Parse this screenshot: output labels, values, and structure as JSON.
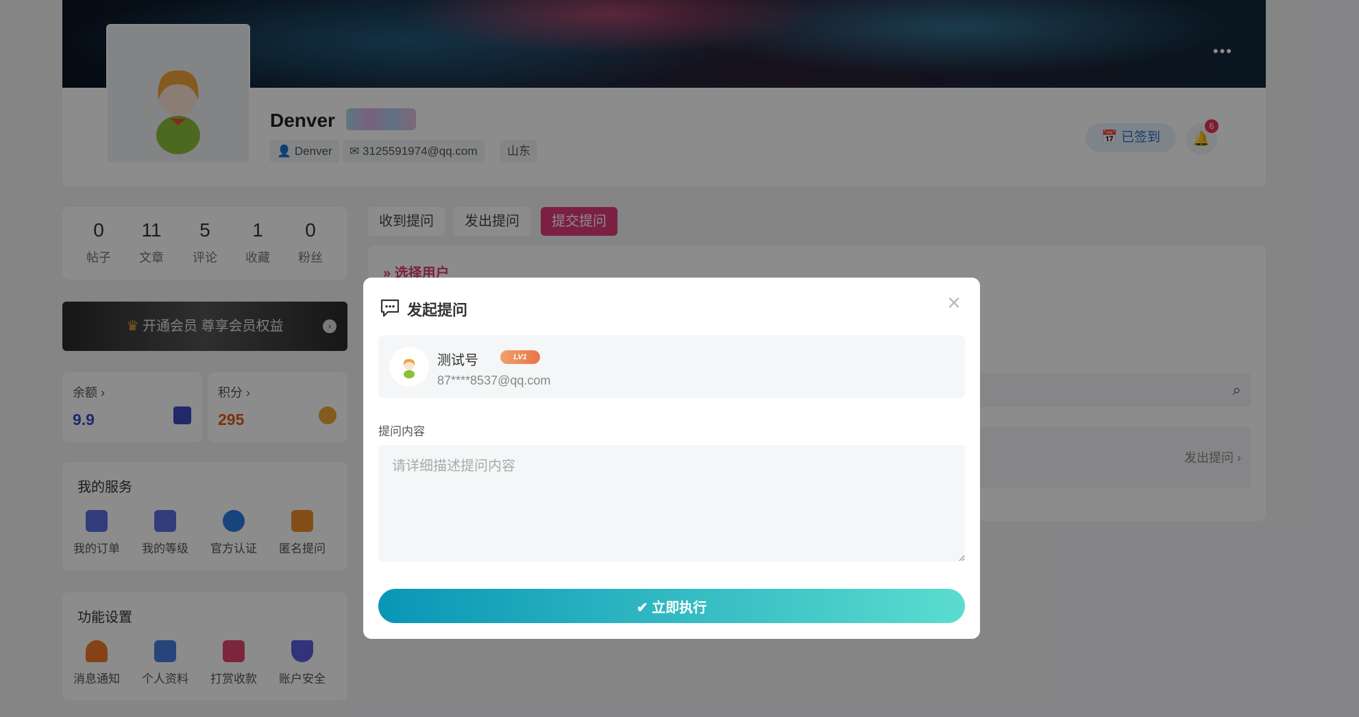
{
  "header": {
    "more_label": "•••",
    "username": "Denver",
    "chips": [
      {
        "icon": "user-icon",
        "text": "Denver"
      },
      {
        "icon": "mail-icon",
        "text": "3125591974@qq.com"
      },
      {
        "icon": "",
        "text": "山东"
      }
    ],
    "signed_label": "已签到",
    "notification_count": "6"
  },
  "stats": [
    {
      "value": "0",
      "label": "帖子"
    },
    {
      "value": "11",
      "label": "文章"
    },
    {
      "value": "5",
      "label": "评论"
    },
    {
      "value": "1",
      "label": "收藏"
    },
    {
      "value": "0",
      "label": "粉丝"
    }
  ],
  "vip_banner": "开通会员 尊享会员权益",
  "balance": {
    "label": "余额 ›",
    "value": "9.9",
    "color": "#3b4cc0"
  },
  "points": {
    "label": "积分 ›",
    "value": "295",
    "color": "#e05a1e"
  },
  "services": {
    "title": "我的服务",
    "items": [
      {
        "label": "我的订单",
        "icon": "order-icon",
        "color": "#5b6ee0"
      },
      {
        "label": "我的等级",
        "icon": "level-icon",
        "color": "#5b6ee0"
      },
      {
        "label": "官方认证",
        "icon": "verified-icon",
        "color": "#2b7de0"
      },
      {
        "label": "匿名提问",
        "icon": "chat-icon",
        "color": "#f08c2a"
      }
    ]
  },
  "features": {
    "title": "功能设置",
    "items": [
      {
        "label": "消息通知",
        "icon": "bell-icon",
        "color": "#f07a2a"
      },
      {
        "label": "个人资料",
        "icon": "profile-icon",
        "color": "#4a7ee0"
      },
      {
        "label": "打赏收款",
        "icon": "gift-icon",
        "color": "#e0456a"
      },
      {
        "label": "账户安全",
        "icon": "shield-icon",
        "color": "#5b5ee0"
      }
    ]
  },
  "tabs": [
    "收到提问",
    "发出提问",
    "提交提问"
  ],
  "content": {
    "section_title": "选择用户",
    "list_action": "发出提问 ›"
  },
  "modal": {
    "title": "发起提问",
    "close": "×",
    "user_name": "测试号",
    "user_level": "LV1",
    "user_email": "87****8537@qq.com",
    "field_label": "提问内容",
    "placeholder": "请详细描述提问内容",
    "submit_label": "✔  立即执行"
  }
}
